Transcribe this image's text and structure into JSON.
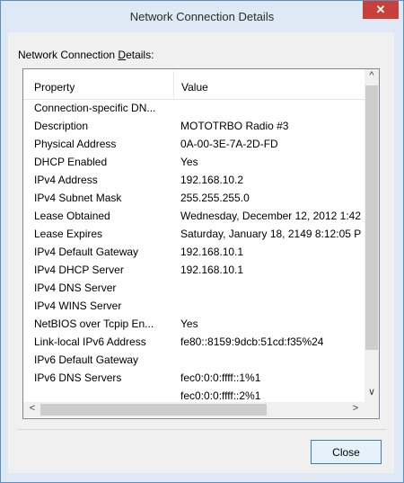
{
  "window": {
    "title": "Network Connection Details",
    "close_glyph": "✕"
  },
  "group_label": "Network Connection Details:",
  "table": {
    "headers": {
      "property": "Property",
      "value": "Value"
    },
    "rows": [
      {
        "property": "Connection-specific DN...",
        "value": ""
      },
      {
        "property": "Description",
        "value": "MOTOTRBO Radio #3"
      },
      {
        "property": "Physical Address",
        "value": "0A-00-3E-7A-2D-FD"
      },
      {
        "property": "DHCP Enabled",
        "value": "Yes"
      },
      {
        "property": "IPv4 Address",
        "value": "192.168.10.2"
      },
      {
        "property": "IPv4 Subnet Mask",
        "value": "255.255.255.0"
      },
      {
        "property": "Lease Obtained",
        "value": "Wednesday, December 12, 2012 1:42"
      },
      {
        "property": "Lease Expires",
        "value": "Saturday, January 18, 2149 8:12:05 P"
      },
      {
        "property": "IPv4 Default Gateway",
        "value": "192.168.10.1"
      },
      {
        "property": "IPv4 DHCP Server",
        "value": "192.168.10.1"
      },
      {
        "property": "IPv4 DNS Server",
        "value": ""
      },
      {
        "property": "IPv4 WINS Server",
        "value": ""
      },
      {
        "property": "NetBIOS over Tcpip En...",
        "value": "Yes"
      },
      {
        "property": "Link-local IPv6 Address",
        "value": "fe80::8159:9dcb:51cd:f35%24"
      },
      {
        "property": "IPv6 Default Gateway",
        "value": ""
      },
      {
        "property": "IPv6 DNS Servers",
        "value": "fec0:0:0:ffff::1%1"
      },
      {
        "property": "",
        "value": "fec0:0:0:ffff::2%1"
      }
    ]
  },
  "scroll_glyphs": {
    "up": "^",
    "down": "∨",
    "left": "<",
    "right": ">"
  },
  "buttons": {
    "close": "Close"
  }
}
